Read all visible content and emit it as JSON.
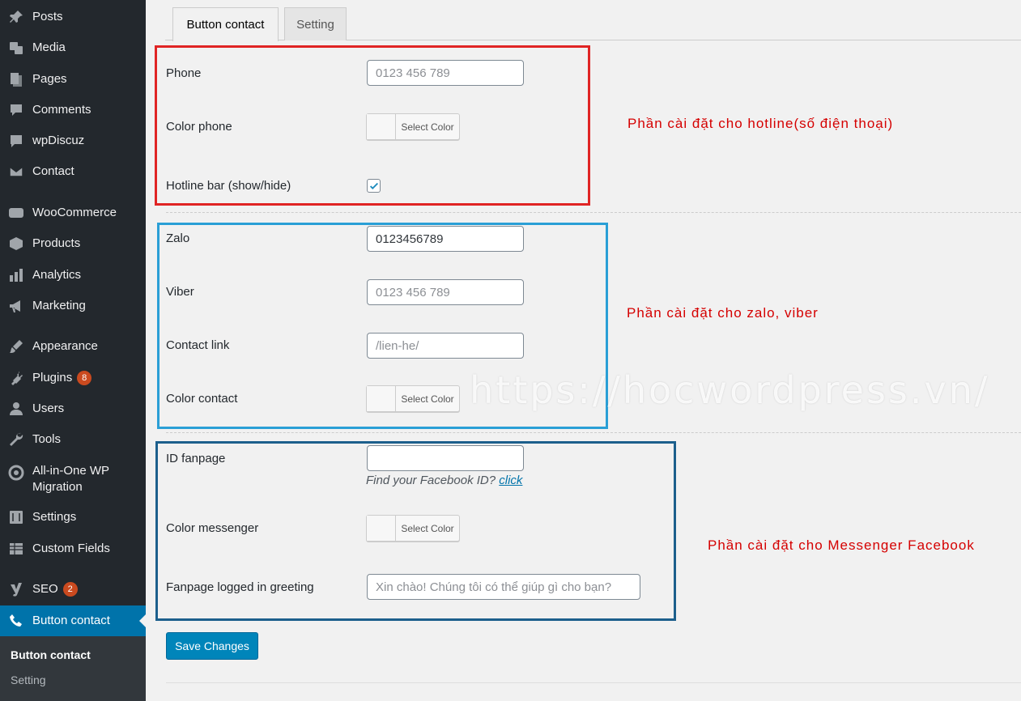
{
  "sidebar": {
    "items": [
      {
        "label": "Posts",
        "icon": "pin-icon"
      },
      {
        "label": "Media",
        "icon": "media-icon"
      },
      {
        "label": "Pages",
        "icon": "pages-icon"
      },
      {
        "label": "Comments",
        "icon": "comment-icon"
      },
      {
        "label": "wpDiscuz",
        "icon": "speech-icon"
      },
      {
        "label": "Contact",
        "icon": "mail-icon"
      },
      {
        "label": "WooCommerce",
        "icon": "woo-icon"
      },
      {
        "label": "Products",
        "icon": "box-icon"
      },
      {
        "label": "Analytics",
        "icon": "bar-chart-icon"
      },
      {
        "label": "Marketing",
        "icon": "megaphone-icon"
      },
      {
        "label": "Appearance",
        "icon": "brush-icon"
      },
      {
        "label": "Plugins",
        "icon": "plug-icon",
        "badge": "8"
      },
      {
        "label": "Users",
        "icon": "user-icon"
      },
      {
        "label": "Tools",
        "icon": "wrench-icon"
      },
      {
        "label": "All-in-One WP Migration",
        "icon": "migration-icon"
      },
      {
        "label": "Settings",
        "icon": "sliders-icon"
      },
      {
        "label": "Custom Fields",
        "icon": "table-icon"
      },
      {
        "label": "SEO",
        "icon": "yoast-icon",
        "badge": "2"
      },
      {
        "label": "Button contact",
        "icon": "phone-icon"
      }
    ],
    "submenu": [
      "Button contact",
      "Setting"
    ]
  },
  "tabs": [
    "Button contact",
    "Setting"
  ],
  "hotline": {
    "phone_label": "Phone",
    "phone_placeholder": "0123 456 789",
    "color_label": "Color phone",
    "bar_label": "Hotline bar (show/hide)",
    "bar_checked": true
  },
  "select_color": "Select Color",
  "zalo": {
    "zalo_label": "Zalo",
    "zalo_value": "0123456789",
    "viber_label": "Viber",
    "viber_placeholder": "0123 456 789",
    "link_label": "Contact link",
    "link_placeholder": "/lien-he/",
    "color_label": "Color contact"
  },
  "messenger": {
    "id_label": "ID fanpage",
    "id_value": "",
    "hint_text": "Find your Facebook ID? ",
    "hint_link": "click",
    "color_label": "Color messenger",
    "greeting_label": "Fanpage logged in greeting",
    "greeting_placeholder": "Xin chào! Chúng tôi có thể giúp gì cho bạn?"
  },
  "annotations": {
    "hotline": "Phần cài đặt cho hotline(số điện thoại)",
    "zalo": "Phần cài đặt cho zalo, viber",
    "messenger": "Phần cài đặt cho Messenger Facebook"
  },
  "watermark": "https://hocwordpress.vn/",
  "save_label": "Save Changes",
  "colors": {
    "sidebar_bg": "#23282d",
    "active": "#0073aa",
    "annotation_red": "#e02424",
    "annotation_cyan": "#2a9fd6",
    "annotation_navy": "#1c5f8c",
    "annotation_text": "#d50000",
    "primary_button": "#0085ba"
  }
}
